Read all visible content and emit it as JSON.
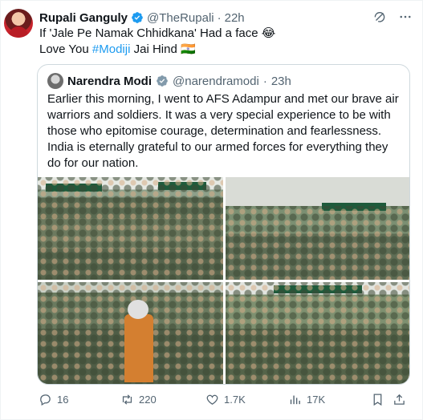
{
  "author": {
    "name": "Rupali Ganguly",
    "handle": "@TheRupali",
    "separator": "·",
    "time": "22h"
  },
  "tweet": {
    "line1": "If 'Jale Pe Namak Chhidkana' Had a face 😂",
    "line2_prefix": "Love You ",
    "line2_hashtag": "#Modiji",
    "line2_suffix": " Jai Hind 🇮🇳"
  },
  "quoted": {
    "name": "Narendra Modi",
    "handle": "@narendramodi",
    "separator": "·",
    "time": "23h",
    "text": "Earlier this morning, I went to AFS Adampur and met our brave air warriors and soldiers. It was a very special experience to be with those who epitomise courage, determination and fearlessness. India is eternally grateful to our armed forces for everything they do for our nation.",
    "photos": [
      "soldiers-group-photo-1",
      "soldiers-group-photo-2",
      "soldiers-group-photo-3",
      "soldiers-group-photo-4"
    ]
  },
  "actions": {
    "replies": "16",
    "retweets": "220",
    "likes": "1.7K",
    "views": "17K"
  },
  "icons": {
    "verified": "verified-badge-icon",
    "grok": "grok-icon",
    "more": "more-icon",
    "reply": "reply-icon",
    "retweet": "retweet-icon",
    "like": "like-icon",
    "views": "views-icon",
    "bookmark": "bookmark-icon",
    "share": "share-icon"
  },
  "colors": {
    "accent": "#1d9bf0",
    "secondary_text": "#536471",
    "border": "#cfd9de"
  }
}
